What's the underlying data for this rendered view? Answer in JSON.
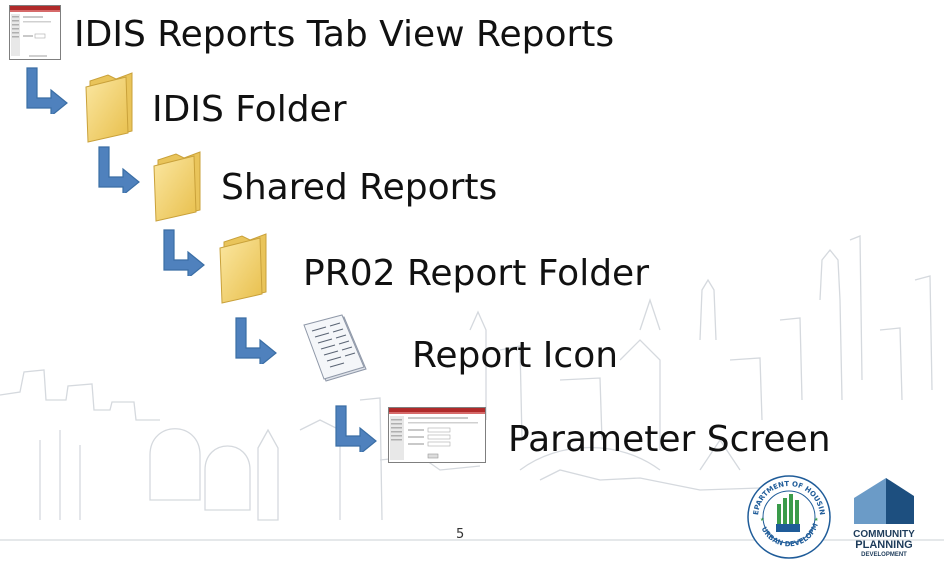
{
  "steps": [
    {
      "label": "IDIS Reports Tab View Reports",
      "icon": "screenshot-thumbnail-icon"
    },
    {
      "label": "IDIS Folder",
      "icon": "folder-icon"
    },
    {
      "label": "Shared Reports",
      "icon": "folder-icon"
    },
    {
      "label": "PR02 Report Folder",
      "icon": "folder-icon"
    },
    {
      "label": "Report Icon",
      "icon": "report-document-icon"
    },
    {
      "label": "Parameter Screen",
      "icon": "screenshot-thumbnail-icon"
    }
  ],
  "page_number": "5",
  "logos": {
    "hud_seal_text_top": "DEPARTMENT OF HOUSING",
    "hud_seal_text_left": "U.S.",
    "hud_seal_text_bottom": "AND URBAN DEVELOPMENT",
    "cpd_line1": "COMMUNITY",
    "cpd_line2": "PLANNING",
    "cpd_line3": "DEVELOPMENT"
  },
  "colors": {
    "arrow_blue": "#4f81bd",
    "folder_yellow": "#f6d77a",
    "hud_blue": "#1f5c99",
    "hud_green": "#3a9b4a",
    "cpd_blue": "#1d4f7f"
  }
}
